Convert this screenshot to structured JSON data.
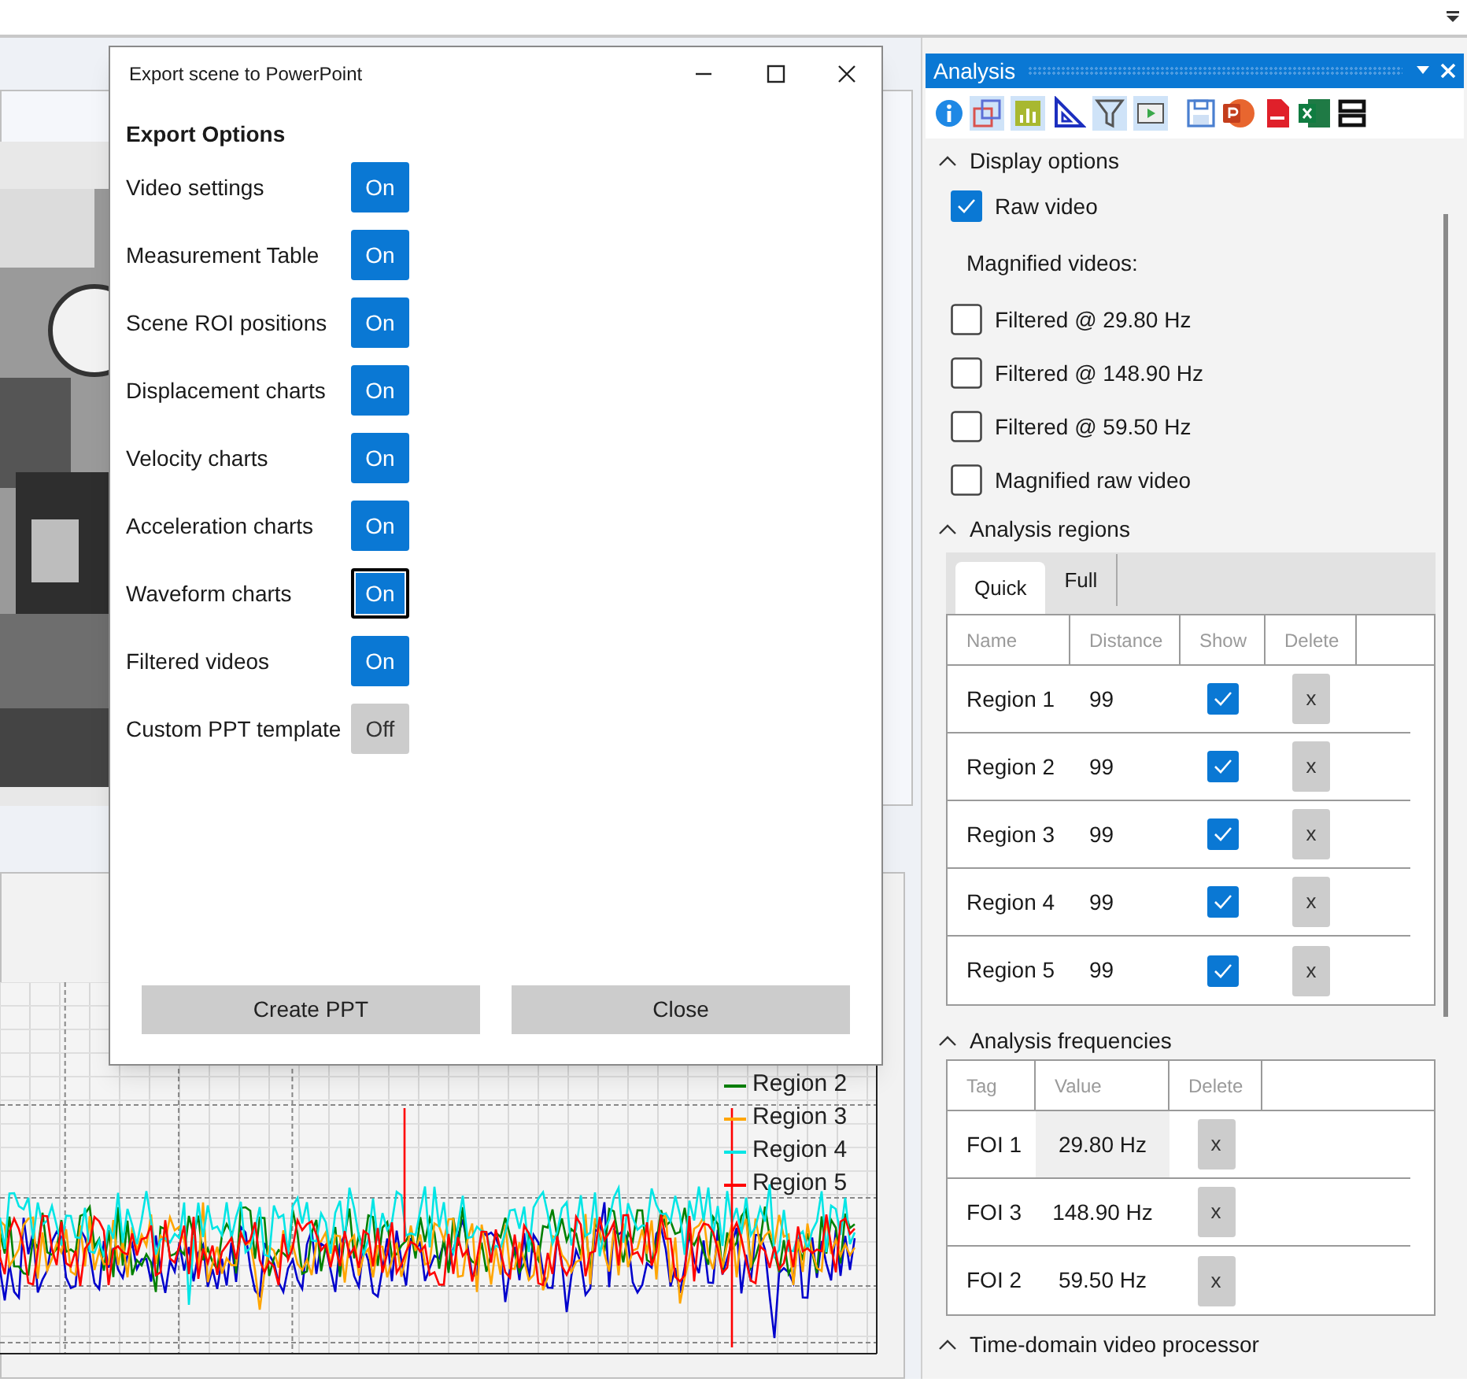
{
  "dialog": {
    "title": "Export scene to PowerPoint",
    "heading": "Export Options",
    "options": [
      {
        "label": "Video settings",
        "value": "On",
        "on": true,
        "focused": false
      },
      {
        "label": "Measurement Table",
        "value": "On",
        "on": true,
        "focused": false
      },
      {
        "label": "Scene ROI positions",
        "value": "On",
        "on": true,
        "focused": false
      },
      {
        "label": "Displacement charts",
        "value": "On",
        "on": true,
        "focused": false
      },
      {
        "label": "Velocity charts",
        "value": "On",
        "on": true,
        "focused": false
      },
      {
        "label": "Acceleration charts",
        "value": "On",
        "on": true,
        "focused": false
      },
      {
        "label": "Waveform charts",
        "value": "On",
        "on": true,
        "focused": true
      },
      {
        "label": "Filtered videos",
        "value": "On",
        "on": true,
        "focused": false
      },
      {
        "label": "Custom PPT template",
        "value": "Off",
        "on": false,
        "focused": false
      }
    ],
    "buttons": [
      "Create PPT",
      "Close"
    ]
  },
  "chart": {
    "legend": [
      {
        "label": "Region 2",
        "color": "#008000"
      },
      {
        "label": "Region 3",
        "color": "#ffa500"
      },
      {
        "label": "Region 4",
        "color": "#00e5e5"
      },
      {
        "label": "Region 5",
        "color": "#ff0000"
      }
    ]
  },
  "panel": {
    "title": "Analysis",
    "display_options": {
      "title": "Display options",
      "expanded": true,
      "items": [
        {
          "kind": "checkbox",
          "label": "Raw video",
          "checked": true
        },
        {
          "kind": "label",
          "label": "Magnified videos:"
        },
        {
          "kind": "checkbox",
          "label": "Filtered @ 29.80 Hz",
          "checked": false
        },
        {
          "kind": "checkbox",
          "label": "Filtered @ 148.90 Hz",
          "checked": false
        },
        {
          "kind": "checkbox",
          "label": "Filtered @ 59.50 Hz",
          "checked": false
        },
        {
          "kind": "checkbox",
          "label": "Magnified raw video",
          "checked": false
        }
      ]
    },
    "analysis_regions": {
      "title": "Analysis regions",
      "expanded": true,
      "tabs": [
        {
          "label": "Quick",
          "selected": true
        },
        {
          "label": "Full",
          "selected": false
        }
      ],
      "columns": [
        "Name",
        "Distance",
        "Show",
        "Delete"
      ],
      "rows": [
        {
          "name": "Region 1",
          "distance": "99",
          "show": true,
          "delete": "x"
        },
        {
          "name": "Region 2",
          "distance": "99",
          "show": true,
          "delete": "x"
        },
        {
          "name": "Region 3",
          "distance": "99",
          "show": true,
          "delete": "x"
        },
        {
          "name": "Region 4",
          "distance": "99",
          "show": true,
          "delete": "x"
        },
        {
          "name": "Region 5",
          "distance": "99",
          "show": true,
          "delete": "x"
        }
      ]
    },
    "analysis_frequencies": {
      "title": "Analysis frequencies",
      "expanded": true,
      "columns": [
        "Tag",
        "Value",
        "Delete"
      ],
      "rows": [
        {
          "tag": "FOI 1",
          "value": "29.80 Hz",
          "delete": "x",
          "selected": true
        },
        {
          "tag": "FOI 3",
          "value": "148.90 Hz",
          "delete": "x",
          "selected": false
        },
        {
          "tag": "FOI 2",
          "value": "59.50 Hz",
          "delete": "x",
          "selected": false
        }
      ]
    },
    "next_section": {
      "title": "Time-domain video processor",
      "expanded": true
    }
  }
}
